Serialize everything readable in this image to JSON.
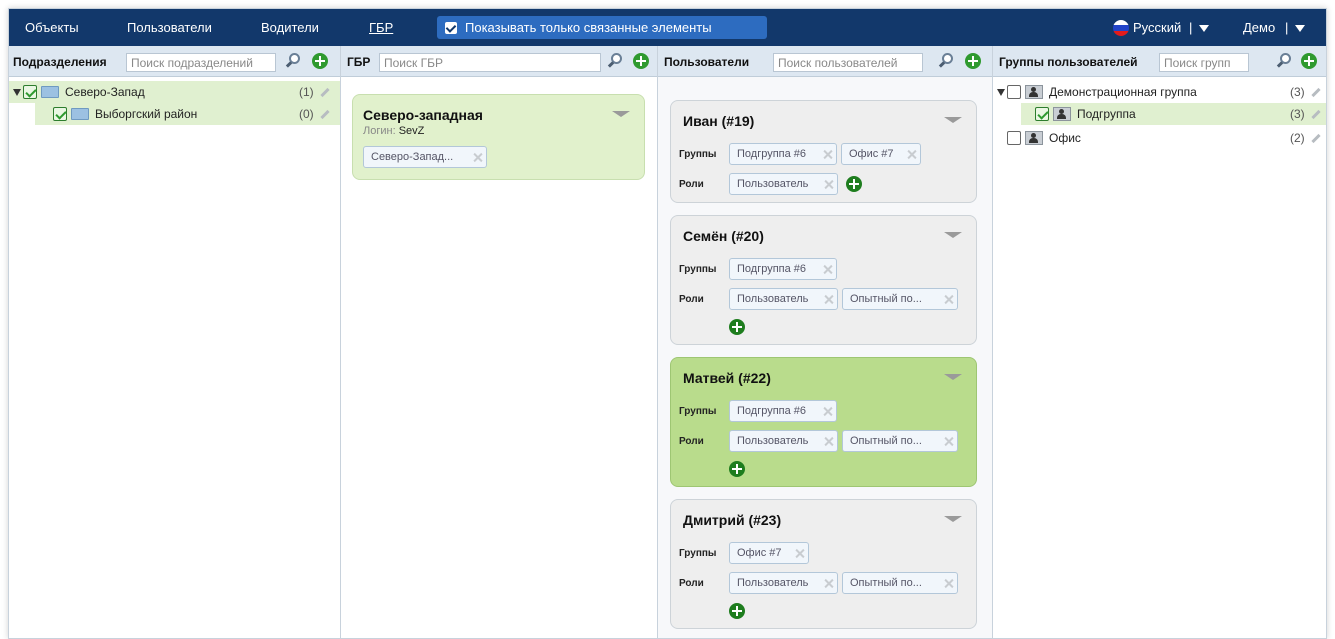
{
  "topbar": {
    "nav": [
      "Объекты",
      "Пользователи",
      "Водители",
      "ГБР"
    ],
    "toggle_label": "Показывать только связанные элементы",
    "language": "Русский",
    "separator": "|",
    "user": "Демо"
  },
  "columns": {
    "divisions": {
      "title": "Подразделения",
      "placeholder": "Поиск подразделений",
      "items": [
        {
          "label": "Северо-Запад",
          "count": "(1)"
        },
        {
          "label": "Выборгский район",
          "count": "(0)"
        }
      ]
    },
    "gbr": {
      "title": "ГБР",
      "placeholder": "Поиск ГБР",
      "card": {
        "name": "Северо-западная",
        "login_label": "Логин:",
        "login_value": "SevZ",
        "tag": "Северо-Запад..."
      }
    },
    "users": {
      "title": "Пользователи",
      "placeholder": "Поиск пользователей",
      "groups_label": "Группы",
      "roles_label": "Роли",
      "cards": [
        {
          "name": "Иван (#19)",
          "groups": [
            "Подгруппа #6",
            "Офис #7"
          ],
          "roles": [
            "Пользователь"
          ]
        },
        {
          "name": "Семён (#20)",
          "groups": [
            "Подгруппа #6"
          ],
          "roles": [
            "Пользователь",
            "Опытный по..."
          ]
        },
        {
          "name": "Матвей (#22)",
          "groups": [
            "Подгруппа #6"
          ],
          "roles": [
            "Пользователь",
            "Опытный по..."
          ]
        },
        {
          "name": "Дмитрий (#23)",
          "groups": [
            "Офис #7"
          ],
          "roles": [
            "Пользователь",
            "Опытный по..."
          ]
        }
      ]
    },
    "user_groups": {
      "title": "Группы пользователей",
      "placeholder": "Поиск групп",
      "items": [
        {
          "label": "Демонстрационная группа",
          "count": "(3)"
        },
        {
          "label": "Подгруппа",
          "count": "(3)"
        },
        {
          "label": "Офис",
          "count": "(2)"
        }
      ]
    }
  },
  "colors": {
    "topbar": "#12386b",
    "toggle": "#2d6cc0",
    "selected_row": "#e0f0d0",
    "selected_card": "#b9dc8c",
    "add": "#2f9a2f"
  }
}
